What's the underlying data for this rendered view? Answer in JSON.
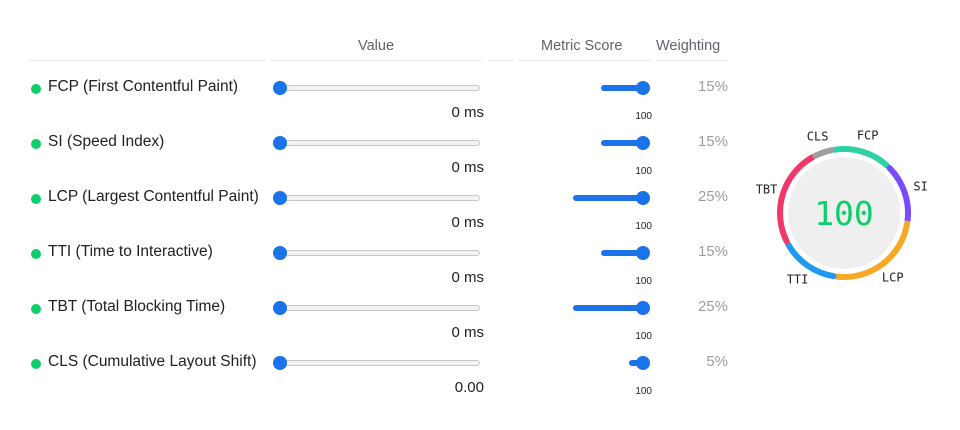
{
  "headers": {
    "value": "Value",
    "metric_score": "Metric Score",
    "weighting": "Weighting"
  },
  "metrics": [
    {
      "name": "FCP (First Contentful Paint)",
      "value": "0 ms",
      "value_slider_fraction": 0,
      "score": "100",
      "score_fraction": 1.0,
      "weight": "15%",
      "weight_fraction": 0.15,
      "status_color": "#0cce6b"
    },
    {
      "name": "SI (Speed Index)",
      "value": "0 ms",
      "value_slider_fraction": 0,
      "score": "100",
      "score_fraction": 1.0,
      "weight": "15%",
      "weight_fraction": 0.15,
      "status_color": "#0cce6b"
    },
    {
      "name": "LCP (Largest Contentful Paint)",
      "value": "0 ms",
      "value_slider_fraction": 0,
      "score": "100",
      "score_fraction": 1.0,
      "weight": "25%",
      "weight_fraction": 0.25,
      "status_color": "#0cce6b"
    },
    {
      "name": "TTI (Time to Interactive)",
      "value": "0 ms",
      "value_slider_fraction": 0,
      "score": "100",
      "score_fraction": 1.0,
      "weight": "15%",
      "weight_fraction": 0.15,
      "status_color": "#0cce6b"
    },
    {
      "name": "TBT (Total Blocking Time)",
      "value": "0 ms",
      "value_slider_fraction": 0,
      "score": "100",
      "score_fraction": 1.0,
      "weight": "25%",
      "weight_fraction": 0.25,
      "status_color": "#0cce6b"
    },
    {
      "name": "CLS (Cumulative Layout Shift)",
      "value": "0.00",
      "value_slider_fraction": 0,
      "score": "100",
      "score_fraction": 1.0,
      "weight": "5%",
      "weight_fraction": 0.05,
      "status_color": "#0cce6b"
    }
  ],
  "gauge": {
    "score": "100",
    "score_color": "#0cce6b",
    "segments": [
      {
        "label": "FCP",
        "weight": 15,
        "color": "#2fd0a6"
      },
      {
        "label": "SI",
        "weight": 15,
        "color": "#7b4bff"
      },
      {
        "label": "LCP",
        "weight": 25,
        "color": "#f9a825"
      },
      {
        "label": "TTI",
        "weight": 15,
        "color": "#1e9bf0"
      },
      {
        "label": "TBT",
        "weight": 25,
        "color": "#f0386b"
      },
      {
        "label": "CLS",
        "weight": 5,
        "color": "#9e9e9e"
      }
    ]
  },
  "colors": {
    "accent": "#1a73e8",
    "pass": "#0cce6b"
  }
}
